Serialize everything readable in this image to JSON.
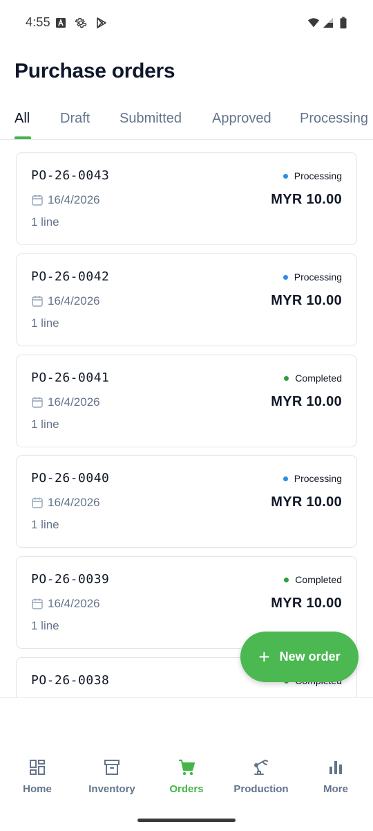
{
  "status_bar": {
    "time": "4:55"
  },
  "page_title": "Purchase orders",
  "tabs": [
    {
      "label": "All",
      "active": true
    },
    {
      "label": "Draft",
      "active": false
    },
    {
      "label": "Submitted",
      "active": false
    },
    {
      "label": "Approved",
      "active": false
    },
    {
      "label": "Processing",
      "active": false
    }
  ],
  "orders": [
    {
      "number": "PO-26-0043",
      "date": "16/4/2026",
      "lines": "1 line",
      "status": "Processing",
      "status_color": "#2b8fe3",
      "amount": "MYR 10.00"
    },
    {
      "number": "PO-26-0042",
      "date": "16/4/2026",
      "lines": "1 line",
      "status": "Processing",
      "status_color": "#2b8fe3",
      "amount": "MYR 10.00"
    },
    {
      "number": "PO-26-0041",
      "date": "16/4/2026",
      "lines": "1 line",
      "status": "Completed",
      "status_color": "#2e9e3e",
      "amount": "MYR 10.00"
    },
    {
      "number": "PO-26-0040",
      "date": "16/4/2026",
      "lines": "1 line",
      "status": "Processing",
      "status_color": "#2b8fe3",
      "amount": "MYR 10.00"
    },
    {
      "number": "PO-26-0039",
      "date": "16/4/2026",
      "lines": "1 line",
      "status": "Completed",
      "status_color": "#2e9e3e",
      "amount": "MYR 10.00"
    },
    {
      "number": "PO-26-0038",
      "date": "",
      "lines": "",
      "status": "Completed",
      "status_color": "#2e9e3e",
      "amount": ""
    }
  ],
  "fab": {
    "label": "New order",
    "icon": "plus-icon"
  },
  "bottom_nav": [
    {
      "label": "Home",
      "icon": "dashboard-icon",
      "active": false
    },
    {
      "label": "Inventory",
      "icon": "archive-box-icon",
      "active": false
    },
    {
      "label": "Orders",
      "icon": "cart-icon",
      "active": true
    },
    {
      "label": "Production",
      "icon": "robot-arm-icon",
      "active": false
    },
    {
      "label": "More",
      "icon": "bar-chart-icon",
      "active": false
    }
  ],
  "colors": {
    "accent": "#43b649",
    "text": "#0f172a",
    "muted": "#64748b",
    "processing": "#2b8fe3",
    "completed": "#2e9e3e"
  }
}
